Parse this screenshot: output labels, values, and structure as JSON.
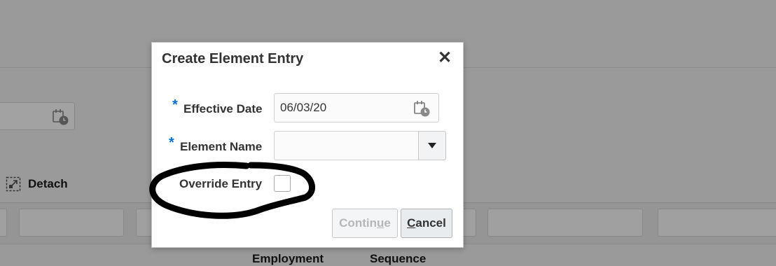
{
  "background": {
    "detach_label": "Detach",
    "column_headers": [
      "Employment",
      "Sequence"
    ]
  },
  "dialog": {
    "title": "Create Element Entry",
    "close_glyph": "✕",
    "effective_date": {
      "required_marker": "*",
      "label": "Effective Date",
      "value": "06/03/20",
      "icon": "calendar-icon"
    },
    "element_name": {
      "required_marker": "*",
      "label": "Element Name",
      "value": "",
      "icon": "chevron-down-icon"
    },
    "override_entry": {
      "label": "Override Entry",
      "checked": false
    },
    "buttons": {
      "continue": {
        "pre": "Contin",
        "mnemonic": "u",
        "post": "e",
        "enabled": false
      },
      "cancel": {
        "pre": "",
        "mnemonic": "C",
        "post": "ancel",
        "enabled": true
      }
    }
  },
  "annotation": {
    "shape": "hand-drawn-circle",
    "color": "#000000",
    "target": "override_entry"
  },
  "colors": {
    "required_marker": "#0572ce",
    "overlay": "#9a9a9a"
  }
}
